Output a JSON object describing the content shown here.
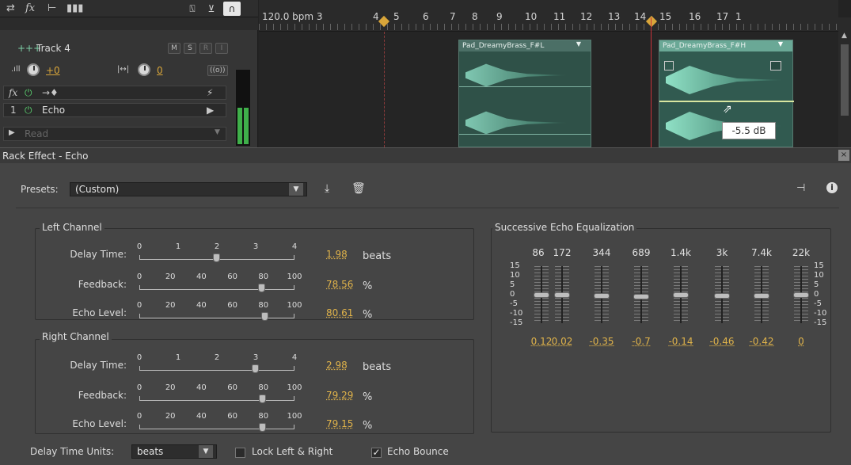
{
  "toolbar": {
    "icons": [
      "swap-icon",
      "fx-icon",
      "send-icon",
      "meter-icon",
      "input-monitor-icon",
      "record-arm-icon",
      "headphones-icon"
    ],
    "fx_label": "fx"
  },
  "ruler": {
    "tempo": "120.0 bpm 3",
    "numbers": [
      "4",
      "5",
      "6",
      "7",
      "8",
      "9",
      "10",
      "11",
      "12",
      "13",
      "14",
      "15",
      "16",
      "17",
      "1"
    ]
  },
  "track": {
    "name": "Track 4",
    "mute": "M",
    "solo": "S",
    "arm": "R",
    "monitor": "I",
    "volume": "+0",
    "pan": "0",
    "fx_label": "fx",
    "effect_slot_number": "1",
    "effect_name": "Echo",
    "automation_mode": "Read"
  },
  "clips": [
    {
      "name": "Pad_DreamyBrass_F#L"
    },
    {
      "name": "Pad_DreamyBrass_F#H"
    }
  ],
  "tooltip": "-5.5 dB",
  "effect_window": {
    "title": "Rack Effect - Echo",
    "presets_label": "Presets:",
    "preset_value": "(Custom)",
    "left_channel": {
      "title": "Left Channel",
      "delay_label": "Delay Time:",
      "delay_value": "1.98",
      "delay_unit": "beats",
      "feedback_label": "Feedback:",
      "feedback_value": "78.56",
      "feedback_unit": "%",
      "echo_label": "Echo Level:",
      "echo_value": "80.61",
      "echo_unit": "%"
    },
    "right_channel": {
      "title": "Right Channel",
      "delay_label": "Delay Time:",
      "delay_value": "2.98",
      "delay_unit": "beats",
      "feedback_label": "Feedback:",
      "feedback_value": "79.29",
      "feedback_unit": "%",
      "echo_label": "Echo Level:",
      "echo_value": "79.15",
      "echo_unit": "%"
    },
    "delay_scale": [
      "0",
      "1",
      "2",
      "3",
      "4"
    ],
    "percent_scale": [
      "0",
      "20",
      "40",
      "60",
      "80",
      "100"
    ],
    "eq": {
      "title": "Successive Echo Equalization",
      "bands": [
        "86",
        "172",
        "344",
        "689",
        "1.4k",
        "3k",
        "7.4k",
        "22k"
      ],
      "values": [
        "0.12",
        "0.02",
        "-0.35",
        "-0.7",
        "-0.14",
        "-0.46",
        "-0.42",
        "0"
      ],
      "scale": [
        "15",
        "10",
        "5",
        "0",
        "-5",
        "-10",
        "-15"
      ]
    },
    "delay_units_label": "Delay Time Units:",
    "delay_units_value": "beats",
    "lock_label": "Lock Left & Right",
    "lock_checked": false,
    "bounce_label": "Echo Bounce",
    "bounce_checked": true,
    "bounce_mark": "✓"
  },
  "colors": {
    "accent": "#e0b34a",
    "clip": "#2f5148",
    "playhead": "#c8323a"
  }
}
